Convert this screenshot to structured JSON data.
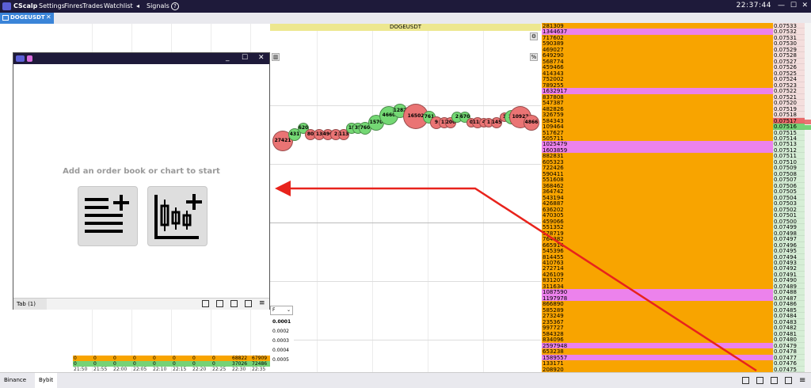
{
  "menubar": {
    "app_name": "CScalp",
    "items": [
      "Settings",
      "Finres",
      "Trades",
      "Watchlist"
    ],
    "arrow": "◂",
    "signals": "Signals",
    "help": "?",
    "clock": "22:37:44",
    "minimize": "—",
    "maximize": "☐",
    "close": "✕"
  },
  "tabs": {
    "active": "DOGEUSDT",
    "close": "✕"
  },
  "chart": {
    "symbol": "DOGEUSDT",
    "percent_label": "%",
    "trade_bubbles": [
      {
        "label": "27421",
        "side": "sell"
      },
      {
        "label": "431",
        "side": "buy"
      },
      {
        "label": "620",
        "side": "buy"
      },
      {
        "label": "80",
        "side": "sell"
      },
      {
        "label": "13",
        "side": "sell"
      },
      {
        "label": "490",
        "side": "sell"
      },
      {
        "label": "2",
        "side": "sell"
      },
      {
        "label": "113",
        "side": "sell"
      },
      {
        "label": "18",
        "side": "buy"
      },
      {
        "label": "35",
        "side": "buy"
      },
      {
        "label": "760",
        "side": "buy"
      },
      {
        "label": "1570",
        "side": "buy"
      },
      {
        "label": "4660",
        "side": "buy"
      },
      {
        "label": "1282",
        "side": "buy"
      },
      {
        "label": "16502",
        "side": "sell"
      },
      {
        "label": "761",
        "side": "buy"
      },
      {
        "label": "9",
        "side": "sell"
      },
      {
        "label": "11",
        "side": "sell"
      },
      {
        "label": "200",
        "side": "sell"
      },
      {
        "label": "2",
        "side": "buy"
      },
      {
        "label": "670",
        "side": "buy"
      },
      {
        "label": "0",
        "side": "sell"
      },
      {
        "label": "114",
        "side": "sell"
      },
      {
        "label": "4",
        "side": "sell"
      },
      {
        "label": "1",
        "side": "sell"
      },
      {
        "label": "145",
        "side": "sell"
      },
      {
        "label": "1",
        "side": "sell"
      },
      {
        "label": "15",
        "side": "buy"
      },
      {
        "label": "10927",
        "side": "sell"
      },
      {
        "label": "4866",
        "side": "sell"
      }
    ]
  },
  "orderbook": {
    "rows": [
      {
        "qty": "281309",
        "price": "0.07533",
        "pink": false
      },
      {
        "qty": "1344637",
        "price": "0.07532",
        "pink": true
      },
      {
        "qty": "717602",
        "price": "0.07531",
        "pink": false
      },
      {
        "qty": "590389",
        "price": "0.07530",
        "pink": false
      },
      {
        "qty": "469027",
        "price": "0.07529",
        "pink": false
      },
      {
        "qty": "649290",
        "price": "0.07528",
        "pink": false
      },
      {
        "qty": "568774",
        "price": "0.07527",
        "pink": false
      },
      {
        "qty": "459466",
        "price": "0.07526",
        "pink": false
      },
      {
        "qty": "414343",
        "price": "0.07525",
        "pink": false
      },
      {
        "qty": "752002",
        "price": "0.07524",
        "pink": false
      },
      {
        "qty": "789255",
        "price": "0.07523",
        "pink": false
      },
      {
        "qty": "1632917",
        "price": "0.07522",
        "pink": true
      },
      {
        "qty": "837808",
        "price": "0.07521",
        "pink": false
      },
      {
        "qty": "547387",
        "price": "0.07520",
        "pink": false
      },
      {
        "qty": "482826",
        "price": "0.07519",
        "pink": false
      },
      {
        "qty": "326759",
        "price": "0.07518",
        "pink": false
      },
      {
        "qty": "584343",
        "price": "0.07517",
        "pink": false
      },
      {
        "qty": "109464",
        "price": "0.07516",
        "pink": false
      },
      {
        "qty": "517627",
        "price": "0.07515",
        "pink": false
      },
      {
        "qty": "505711",
        "price": "0.07514",
        "pink": false
      },
      {
        "qty": "1025479",
        "price": "0.07513",
        "pink": true
      },
      {
        "qty": "1603859",
        "price": "0.07512",
        "pink": true
      },
      {
        "qty": "882831",
        "price": "0.07511",
        "pink": false
      },
      {
        "qty": "605323",
        "price": "0.07510",
        "pink": false
      },
      {
        "qty": "722426",
        "price": "0.07509",
        "pink": false
      },
      {
        "qty": "590411",
        "price": "0.07508",
        "pink": false
      },
      {
        "qty": "551608",
        "price": "0.07507",
        "pink": false
      },
      {
        "qty": "368462",
        "price": "0.07506",
        "pink": false
      },
      {
        "qty": "364742",
        "price": "0.07505",
        "pink": false
      },
      {
        "qty": "543194",
        "price": "0.07504",
        "pink": false
      },
      {
        "qty": "426887",
        "price": "0.07503",
        "pink": false
      },
      {
        "qty": "636202",
        "price": "0.07502",
        "pink": false
      },
      {
        "qty": "470305",
        "price": "0.07501",
        "pink": false
      },
      {
        "qty": "459066",
        "price": "0.07500",
        "pink": false
      },
      {
        "qty": "551352",
        "price": "0.07499",
        "pink": false
      },
      {
        "qty": "578719",
        "price": "0.07498",
        "pink": false
      },
      {
        "qty": "764382",
        "price": "0.07497",
        "pink": false
      },
      {
        "qty": "665914",
        "price": "0.07496",
        "pink": false
      },
      {
        "qty": "545396",
        "price": "0.07495",
        "pink": false
      },
      {
        "qty": "814455",
        "price": "0.07494",
        "pink": false
      },
      {
        "qty": "410763",
        "price": "0.07493",
        "pink": false
      },
      {
        "qty": "272714",
        "price": "0.07492",
        "pink": false
      },
      {
        "qty": "426109",
        "price": "0.07491",
        "pink": false
      },
      {
        "qty": "831207",
        "price": "0.07490",
        "pink": false
      },
      {
        "qty": "311634",
        "price": "0.07489",
        "pink": false
      },
      {
        "qty": "1087590",
        "price": "0.07488",
        "pink": true
      },
      {
        "qty": "1197978",
        "price": "0.07487",
        "pink": true
      },
      {
        "qty": "866890",
        "price": "0.07486",
        "pink": false
      },
      {
        "qty": "585289",
        "price": "0.07485",
        "pink": false
      },
      {
        "qty": "273249",
        "price": "0.07484",
        "pink": false
      },
      {
        "qty": "235367",
        "price": "0.07483",
        "pink": false
      },
      {
        "qty": "997727",
        "price": "0.07482",
        "pink": false
      },
      {
        "qty": "584328",
        "price": "0.07481",
        "pink": false
      },
      {
        "qty": "834096",
        "price": "0.07480",
        "pink": false
      },
      {
        "qty": "2597948",
        "price": "0.07479",
        "pink": true
      },
      {
        "qty": "653238",
        "price": "0.07478",
        "pink": false
      },
      {
        "qty": "1589557",
        "price": "0.07477",
        "pink": true
      },
      {
        "qty": "133171",
        "price": "0.07476",
        "pink": false
      },
      {
        "qty": "208920",
        "price": "0.07475",
        "pink": false
      }
    ],
    "current_ask_index": 16,
    "current_bid_index": 17
  },
  "window": {
    "minimize": "_",
    "maximize": "☐",
    "close": "✕",
    "empty_message": "Add an order book or chart to start",
    "tab_label": "Tab (1)"
  },
  "ladder": {
    "select_value": "F",
    "levels": [
      "0.0001",
      "0.0002",
      "0.0003",
      "0.0004",
      "0.0005"
    ]
  },
  "clusters": {
    "row_orange": [
      "0",
      "0",
      "0",
      "0",
      "0",
      "0",
      "0",
      "0",
      "68822",
      "67909"
    ],
    "row_green": [
      "0",
      "0",
      "0",
      "0",
      "0",
      "0",
      "0",
      "0",
      "37026",
      "72486"
    ],
    "times": [
      "21:50",
      "21:55",
      "22:00",
      "22:05",
      "22:10",
      "22:15",
      "22:20",
      "22:25",
      "22:30",
      "22:35"
    ]
  },
  "bottom": {
    "exchanges": [
      "Binance",
      "Bybit"
    ]
  },
  "colors": {
    "sell": "#ea7474",
    "buy": "#74d874",
    "book": "#f8a400",
    "pink": "#ec82ec",
    "arrow": "#e8231c"
  }
}
